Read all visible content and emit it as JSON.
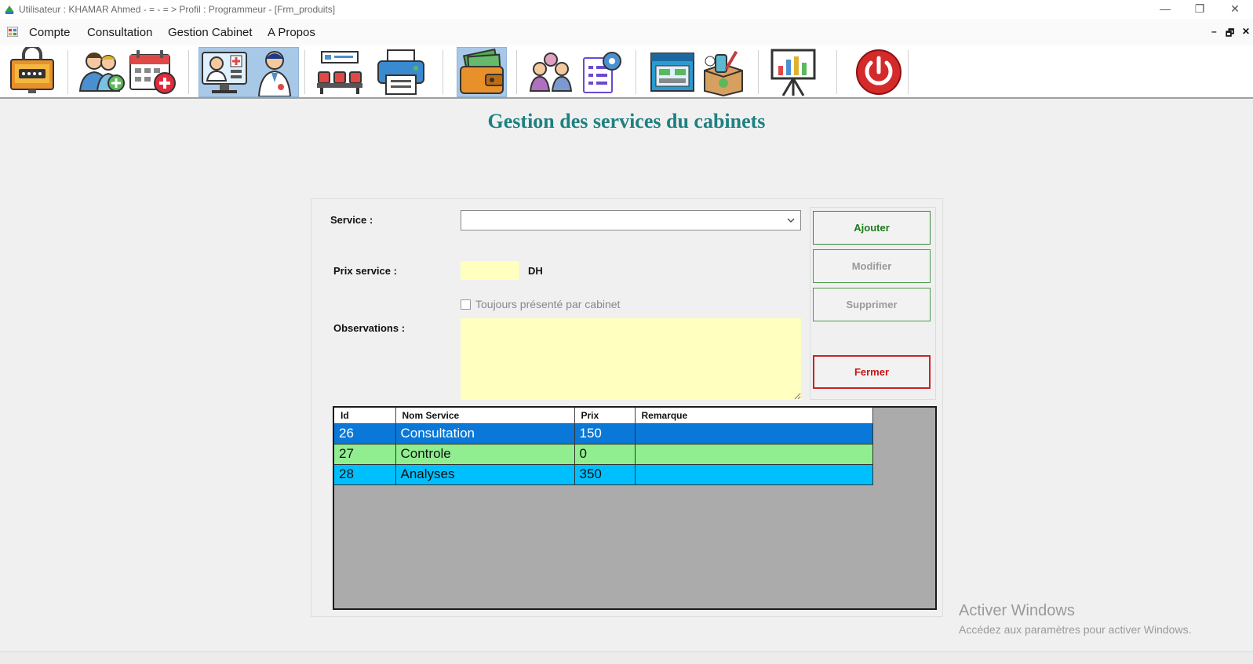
{
  "window": {
    "title": "Utilisateur : KHAMAR  Ahmed - = - = > Profil : Programmeur - [Frm_produits]",
    "minimize": "—",
    "restore": "❐",
    "close": "✕"
  },
  "menu": {
    "items": [
      "Compte",
      "Consultation",
      "Gestion Cabinet",
      "A Propos"
    ],
    "mdi_minimize": "–",
    "mdi_restore": "🗗",
    "mdi_close": "✕"
  },
  "toolbar": {
    "icons": [
      "password-icon",
      "add-patient-icon",
      "calendar-add-icon",
      "doctor-monitor-icon",
      "doctor-icon",
      "waiting-room-icon",
      "printer-icon",
      "wallet-icon",
      "staff-icon",
      "settings-document-icon",
      "pharmacy-icon",
      "medicine-box-icon",
      "chart-board-icon",
      "power-icon"
    ],
    "selected": [
      "doctor-monitor-icon",
      "doctor-icon",
      "wallet-icon"
    ]
  },
  "form": {
    "title": "Gestion des services du cabinets",
    "service_label": "Service :",
    "service_value": "",
    "prix_label": "Prix service :",
    "prix_value": "",
    "prix_unit": "DH",
    "checkbox_label": "Toujours présenté par cabinet",
    "checkbox_checked": false,
    "observations_label": "Observations :",
    "observations_value": ""
  },
  "buttons": {
    "ajouter": "Ajouter",
    "modifier": "Modifier",
    "supprimer": "Supprimer",
    "fermer": "Fermer"
  },
  "grid": {
    "columns": [
      "Id",
      "Nom Service",
      "Prix",
      "Remarque"
    ],
    "rows": [
      {
        "id": "26",
        "nom": "Consultation",
        "prix": "150",
        "remarque": ""
      },
      {
        "id": "27",
        "nom": "Controle",
        "prix": "0",
        "remarque": ""
      },
      {
        "id": "28",
        "nom": "Analyses",
        "prix": "350",
        "remarque": ""
      }
    ],
    "colors": {
      "row0": "#0a78d8",
      "row1": "#90ee90",
      "row2": "#00bfff"
    }
  },
  "watermark": {
    "line1": "Activer Windows",
    "line2": "Accédez aux paramètres pour activer Windows."
  },
  "colors": {
    "title": "#1e8080",
    "input_bg": "#ffffc0",
    "close_btn": "#c81414"
  }
}
